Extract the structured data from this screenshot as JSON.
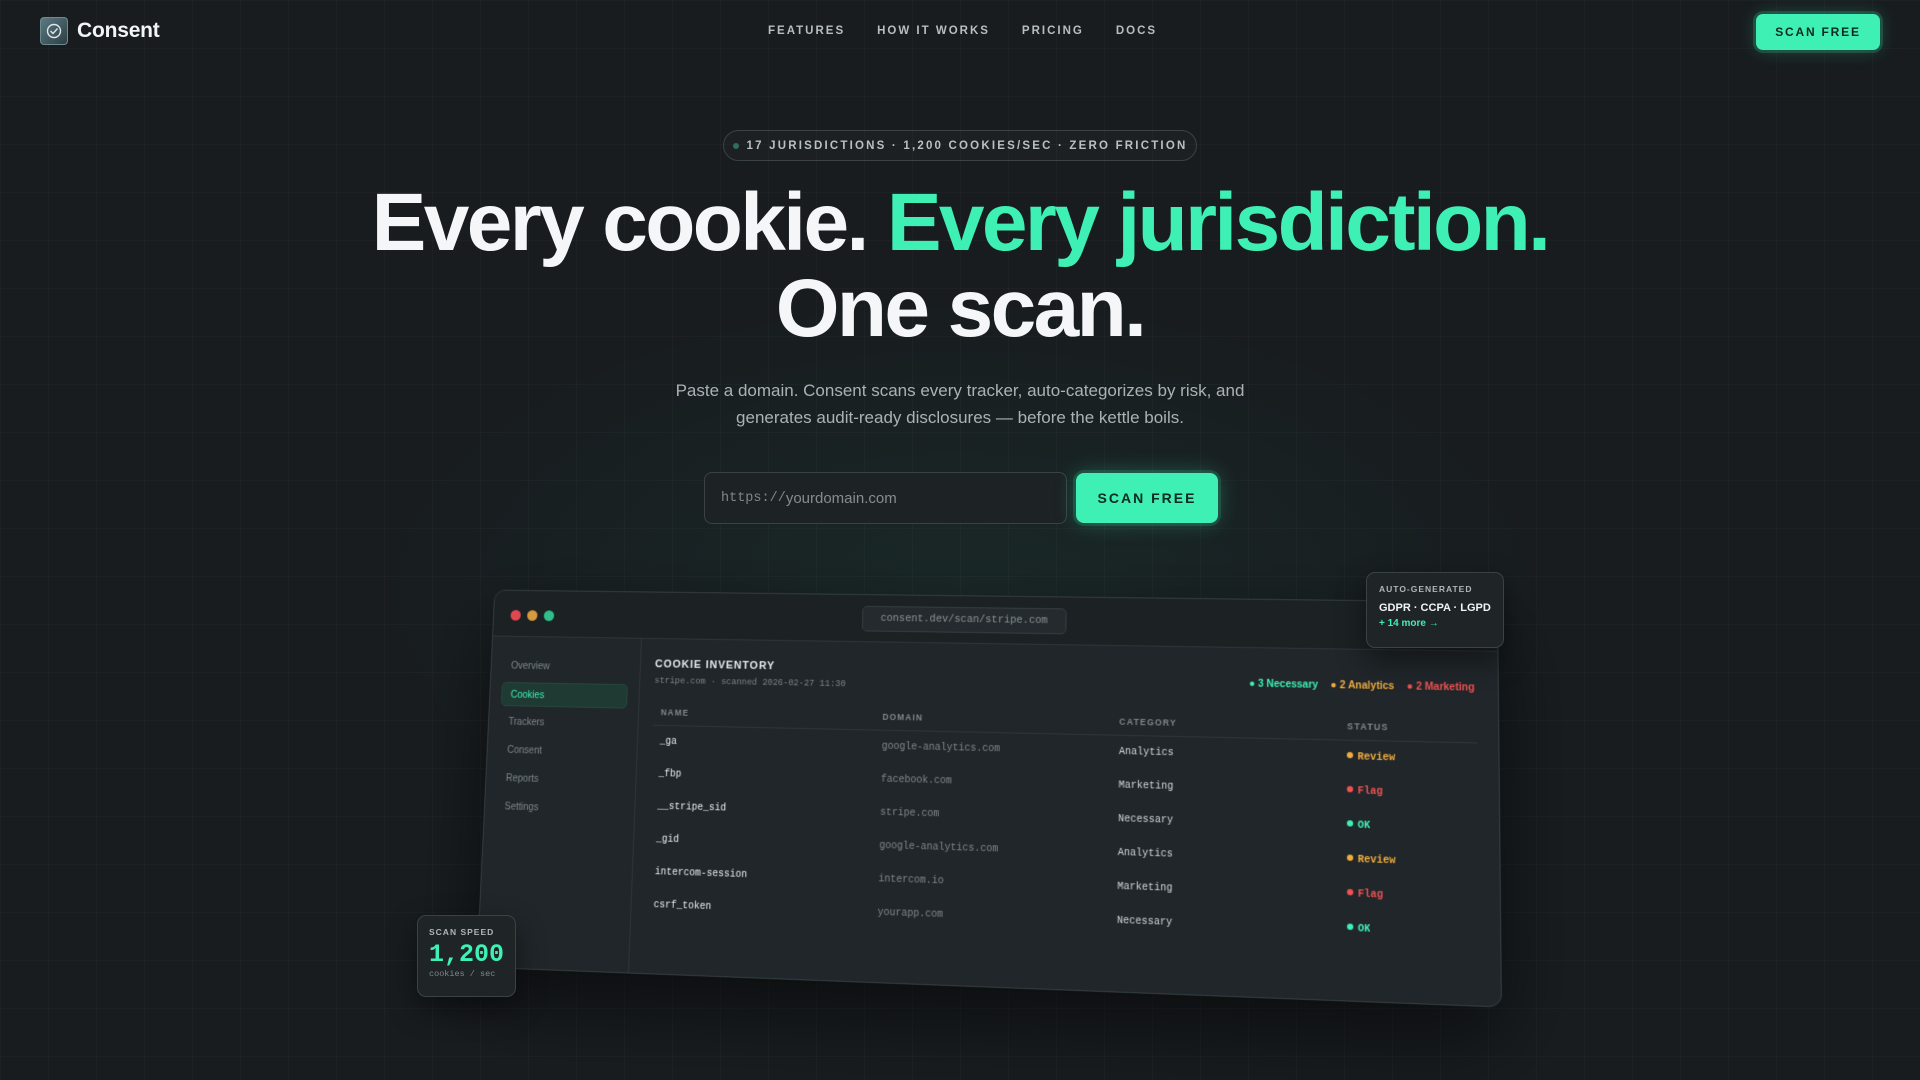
{
  "brand": {
    "name": "Consent"
  },
  "nav": {
    "links": [
      "FEATURES",
      "HOW IT WORKS",
      "PRICING",
      "DOCS"
    ],
    "cta": "SCAN FREE"
  },
  "hero": {
    "pill": "17 JURISDICTIONS · 1,200 COOKIES/SEC · ZERO FRICTION",
    "title_part1": "Every cookie. ",
    "title_accent": "Every jurisdiction.",
    "title_part2": "One scan.",
    "subtitle_line1": "Paste a domain. Consent scans every tracker, auto-categorizes by risk, and",
    "subtitle_line2": "generates audit-ready disclosures — before the kettle boils.",
    "url_prefix": "https://",
    "url_placeholder": "yourdomain.com",
    "scan_button": "SCAN FREE"
  },
  "app": {
    "url": "consent.dev/scan/stripe.com",
    "sidebar": [
      "Overview",
      "Cookies",
      "Trackers",
      "Consent",
      "Reports",
      "Settings"
    ],
    "active_sidebar": "Cookies",
    "title": "COOKIE INVENTORY",
    "subtitle": "stripe.com · scanned 2026-02-27 11:30",
    "legend": [
      {
        "label": "● 3 Necessary",
        "color": "#3ef0b4"
      },
      {
        "label": "● 2 Analytics",
        "color": "#f0ad3e"
      },
      {
        "label": "● 2 Marketing",
        "color": "#f05252"
      }
    ],
    "columns": [
      "NAME",
      "DOMAIN",
      "CATEGORY",
      "STATUS"
    ],
    "rows": [
      {
        "name": "_ga",
        "domain": "google-analytics.com",
        "category": "Analytics",
        "status": "Review",
        "status_color": "#f0ad3e"
      },
      {
        "name": "_fbp",
        "domain": "facebook.com",
        "category": "Marketing",
        "status": "Flag",
        "status_color": "#f05252"
      },
      {
        "name": "__stripe_sid",
        "domain": "stripe.com",
        "category": "Necessary",
        "status": "OK",
        "status_color": "#3ef0b4"
      },
      {
        "name": "_gid",
        "domain": "google-analytics.com",
        "category": "Analytics",
        "status": "Review",
        "status_color": "#f0ad3e"
      },
      {
        "name": "intercom-session",
        "domain": "intercom.io",
        "category": "Marketing",
        "status": "Flag",
        "status_color": "#f05252"
      },
      {
        "name": "csrf_token",
        "domain": "yourapp.com",
        "category": "Necessary",
        "status": "OK",
        "status_color": "#3ef0b4"
      }
    ]
  },
  "cards": {
    "auto": {
      "label": "AUTO-GENERATED",
      "value": "GDPR · CCPA · LGPD",
      "more": "+ 14 more →"
    },
    "speed": {
      "label": "SCAN SPEED",
      "value": "1,200",
      "unit": "cookies / sec"
    }
  },
  "colors": {
    "accent": "#3ef0b4",
    "background": "#181c1f",
    "warning": "#f0ad3e",
    "danger": "#f05252"
  }
}
